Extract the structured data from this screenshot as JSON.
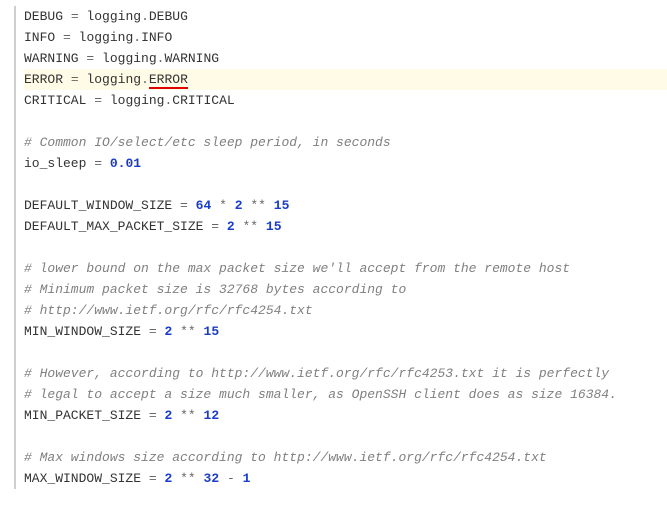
{
  "lines": [
    {
      "hl": false,
      "seg": [
        [
          "DEBUG",
          "kw"
        ],
        [
          " ",
          ""
        ],
        [
          "=",
          "op"
        ],
        [
          " ",
          ""
        ],
        [
          "logging",
          "kw"
        ],
        [
          ".",
          "op"
        ],
        [
          "DEBUG",
          "attr"
        ]
      ]
    },
    {
      "hl": false,
      "seg": [
        [
          "INFO",
          "kw"
        ],
        [
          " ",
          ""
        ],
        [
          "=",
          "op"
        ],
        [
          " ",
          ""
        ],
        [
          "logging",
          "kw"
        ],
        [
          ".",
          "op"
        ],
        [
          "INFO",
          "attr"
        ]
      ]
    },
    {
      "hl": false,
      "seg": [
        [
          "WARNING",
          "kw"
        ],
        [
          " ",
          ""
        ],
        [
          "=",
          "op"
        ],
        [
          " ",
          ""
        ],
        [
          "logging",
          "kw"
        ],
        [
          ".",
          "op"
        ],
        [
          "WARNING",
          "attr"
        ]
      ]
    },
    {
      "hl": true,
      "seg": [
        [
          "ERROR",
          "kw"
        ],
        [
          " ",
          ""
        ],
        [
          "=",
          "op"
        ],
        [
          " ",
          ""
        ],
        [
          "logging",
          "kw"
        ],
        [
          ".",
          "op"
        ],
        [
          "ERROR",
          "err"
        ]
      ]
    },
    {
      "hl": false,
      "seg": [
        [
          "CRITICAL",
          "kw"
        ],
        [
          " ",
          ""
        ],
        [
          "=",
          "op"
        ],
        [
          " ",
          ""
        ],
        [
          "logging",
          "kw"
        ],
        [
          ".",
          "op"
        ],
        [
          "CRITICAL",
          "attr"
        ]
      ]
    },
    {
      "hl": false,
      "seg": [
        [
          "",
          ""
        ]
      ]
    },
    {
      "hl": false,
      "seg": [
        [
          "# Common IO/select/etc sleep period, in seconds",
          "com"
        ]
      ]
    },
    {
      "hl": false,
      "seg": [
        [
          "io_sleep",
          "kw"
        ],
        [
          " ",
          ""
        ],
        [
          "=",
          "op"
        ],
        [
          " ",
          ""
        ],
        [
          "0.01",
          "num"
        ]
      ]
    },
    {
      "hl": false,
      "seg": [
        [
          "",
          ""
        ]
      ]
    },
    {
      "hl": false,
      "seg": [
        [
          "DEFAULT_WINDOW_SIZE",
          "kw"
        ],
        [
          " ",
          ""
        ],
        [
          "=",
          "op"
        ],
        [
          " ",
          ""
        ],
        [
          "64",
          "num"
        ],
        [
          " ",
          ""
        ],
        [
          "*",
          "op"
        ],
        [
          " ",
          ""
        ],
        [
          "2",
          "num"
        ],
        [
          " ",
          ""
        ],
        [
          "**",
          "op"
        ],
        [
          " ",
          ""
        ],
        [
          "15",
          "num"
        ]
      ]
    },
    {
      "hl": false,
      "seg": [
        [
          "DEFAULT_MAX_PACKET_SIZE",
          "kw"
        ],
        [
          " ",
          ""
        ],
        [
          "=",
          "op"
        ],
        [
          " ",
          ""
        ],
        [
          "2",
          "num"
        ],
        [
          " ",
          ""
        ],
        [
          "**",
          "op"
        ],
        [
          " ",
          ""
        ],
        [
          "15",
          "num"
        ]
      ]
    },
    {
      "hl": false,
      "seg": [
        [
          "",
          ""
        ]
      ]
    },
    {
      "hl": false,
      "seg": [
        [
          "# lower bound on the max packet size we'll accept from the remote host",
          "com"
        ]
      ]
    },
    {
      "hl": false,
      "seg": [
        [
          "# Minimum packet size is 32768 bytes according to",
          "com"
        ]
      ]
    },
    {
      "hl": false,
      "seg": [
        [
          "# http://www.ietf.org/rfc/rfc4254.txt",
          "com"
        ]
      ]
    },
    {
      "hl": false,
      "seg": [
        [
          "MIN_WINDOW_SIZE",
          "kw"
        ],
        [
          " ",
          ""
        ],
        [
          "=",
          "op"
        ],
        [
          " ",
          ""
        ],
        [
          "2",
          "num"
        ],
        [
          " ",
          ""
        ],
        [
          "**",
          "op"
        ],
        [
          " ",
          ""
        ],
        [
          "15",
          "num"
        ]
      ]
    },
    {
      "hl": false,
      "seg": [
        [
          "",
          ""
        ]
      ]
    },
    {
      "hl": false,
      "seg": [
        [
          "# However, according to http://www.ietf.org/rfc/rfc4253.txt it is perfectly",
          "com"
        ]
      ]
    },
    {
      "hl": false,
      "seg": [
        [
          "# legal to accept a size much smaller, as OpenSSH client does as size 16384.",
          "com"
        ]
      ]
    },
    {
      "hl": false,
      "seg": [
        [
          "MIN_PACKET_SIZE",
          "kw"
        ],
        [
          " ",
          ""
        ],
        [
          "=",
          "op"
        ],
        [
          " ",
          ""
        ],
        [
          "2",
          "num"
        ],
        [
          " ",
          ""
        ],
        [
          "**",
          "op"
        ],
        [
          " ",
          ""
        ],
        [
          "12",
          "num"
        ]
      ]
    },
    {
      "hl": false,
      "seg": [
        [
          "",
          ""
        ]
      ]
    },
    {
      "hl": false,
      "seg": [
        [
          "# Max windows size according to http://www.ietf.org/rfc/rfc4254.txt",
          "com"
        ]
      ]
    },
    {
      "hl": false,
      "seg": [
        [
          "MAX_WINDOW_SIZE",
          "kw"
        ],
        [
          " ",
          ""
        ],
        [
          "=",
          "op"
        ],
        [
          " ",
          ""
        ],
        [
          "2",
          "num"
        ],
        [
          " ",
          ""
        ],
        [
          "**",
          "op"
        ],
        [
          " ",
          ""
        ],
        [
          "32",
          "num"
        ],
        [
          " ",
          ""
        ],
        [
          "-",
          "op"
        ],
        [
          " ",
          ""
        ],
        [
          "1",
          "num"
        ]
      ]
    }
  ]
}
